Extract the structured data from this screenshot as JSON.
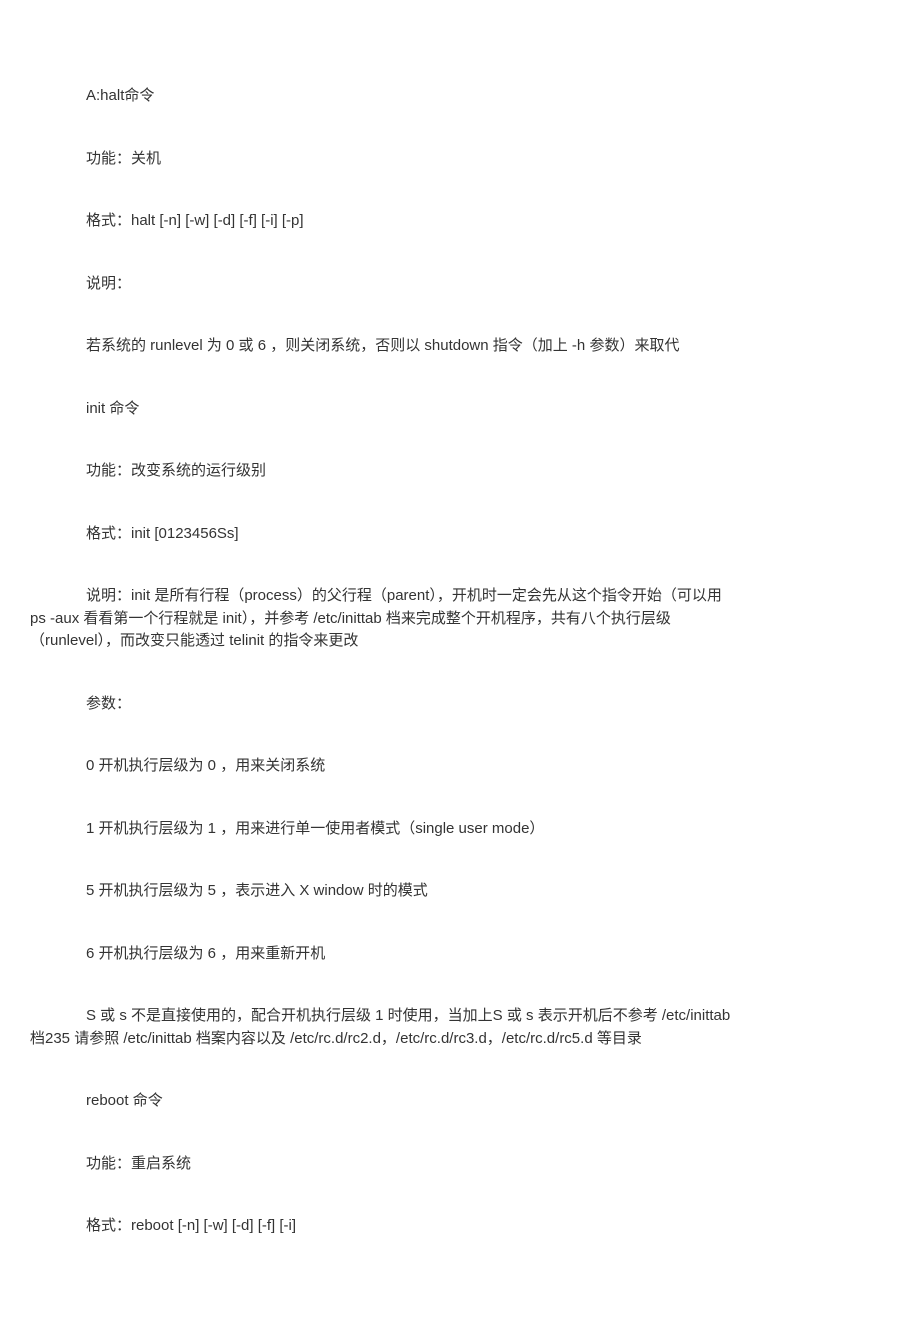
{
  "paragraphs": {
    "p1": "A:halt命令",
    "p2": "功能：关机",
    "p3": "格式：halt [-n] [-w] [-d] [-f] [-i] [-p]",
    "p4": "说明：",
    "p5": "若系统的 runlevel 为 0 或 6 ，则关闭系统，否则以 shutdown 指令（加上 -h 参数）来取代",
    "p6": "init 命令",
    "p7": "功能：改变系统的运行级别",
    "p8": "格式：init [0123456Ss]",
    "p9_line1": "说明：init 是所有行程（process）的父行程（parent），开机时一定会先从这个指令开始（可以用",
    "p9_line2": "ps -aux 看看第一个行程就是 init），并参考 /etc/inittab 档来完成整个开机程序，共有八个执行层级",
    "p9_line3": "（runlevel），而改变只能透过 telinit 的指令来更改",
    "p10": "参数：",
    "p11": "0 开机执行层级为 0 ，用来关闭系统",
    "p12": "1 开机执行层级为 1 ，用来进行单一使用者模式（single user mode）",
    "p13": "5 开机执行层级为 5 ，表示进入 X window 时的模式",
    "p14": "6 开机执行层级为 6 ，用来重新开机",
    "p15_line1": "S 或 s 不是直接使用的，配合开机执行层级 1 时使用，当加上S 或 s 表示开机后不参考 /etc/inittab",
    "p15_line2": "档235 请参照 /etc/inittab 档案内容以及 /etc/rc.d/rc2.d，/etc/rc.d/rc3.d，/etc/rc.d/rc5.d 等目录",
    "p16": "reboot 命令",
    "p17": "功能：重启系统",
    "p18": "格式：reboot [-n] [-w] [-d] [-f] [-i]"
  }
}
